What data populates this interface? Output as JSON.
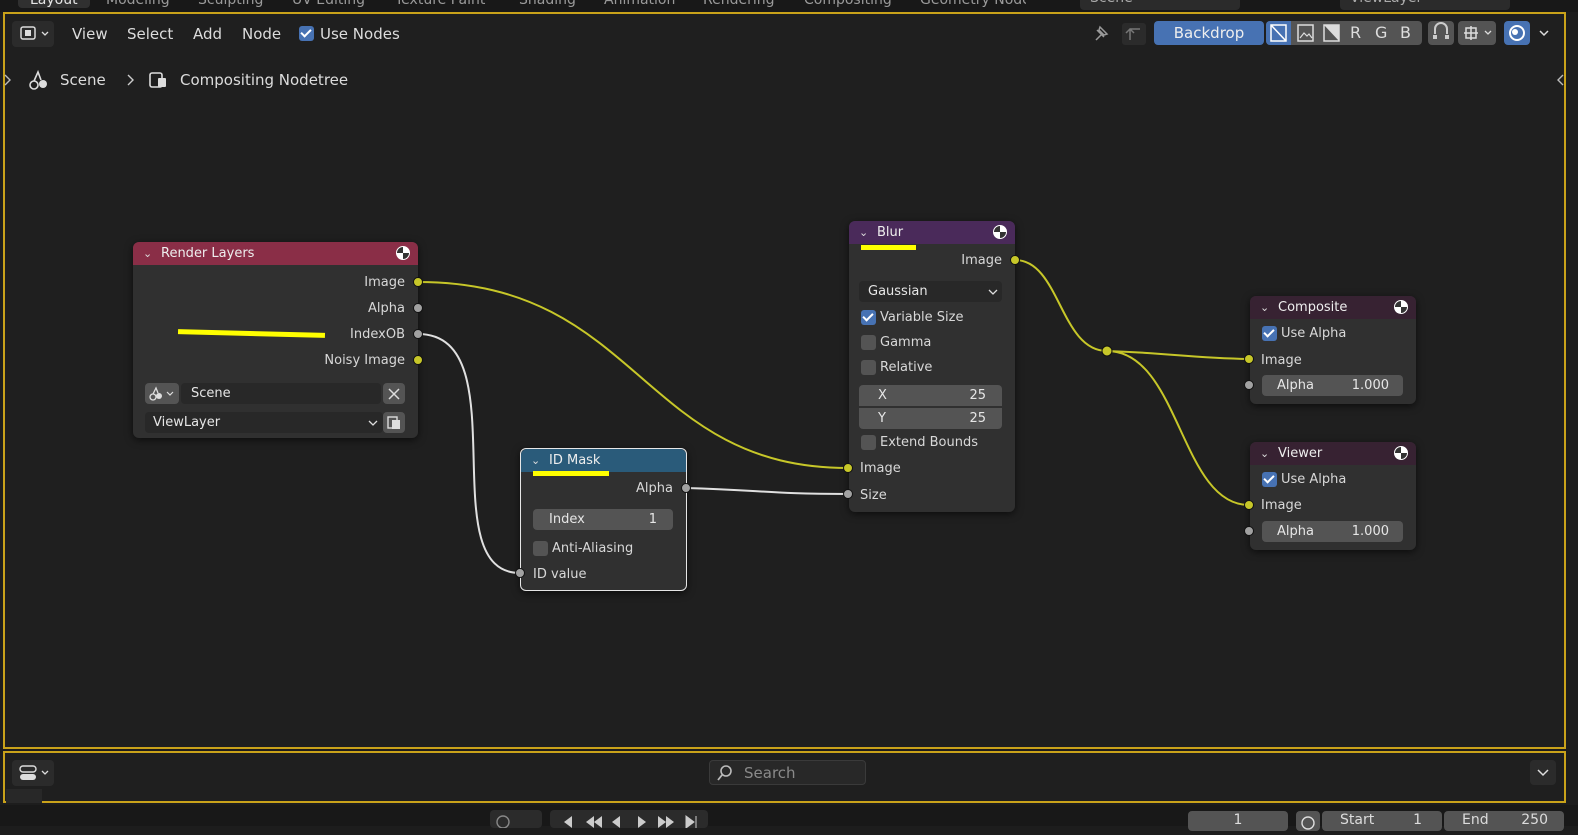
{
  "workspace_tabs": [
    "Layout",
    "Modeling",
    "Sculpting",
    "UV Editing",
    "Texture Paint",
    "Shading",
    "Animation",
    "Rendering",
    "Compositing",
    "Geometry Nodes"
  ],
  "scene_field": "Scene",
  "view_layer_field": "ViewLayer",
  "header": {
    "menus": [
      "View",
      "Select",
      "Add",
      "Node"
    ],
    "use_nodes_label": "Use Nodes",
    "backdrop_label": "Backdrop",
    "channel_buttons": [
      "R",
      "G",
      "B"
    ]
  },
  "breadcrumb": {
    "scene": "Scene",
    "nodetree": "Compositing Nodetree"
  },
  "nodes": {
    "render_layers": {
      "title": "Render Layers",
      "outputs": [
        "Image",
        "Alpha",
        "IndexOB",
        "Noisy Image"
      ],
      "scene": "Scene",
      "view_layer": "ViewLayer",
      "header_color": "#8a2e47"
    },
    "id_mask": {
      "title": "ID Mask",
      "output": "Alpha",
      "index_label": "Index",
      "index_value": "1",
      "anti_aliasing": "Anti-Aliasing",
      "input": "ID value",
      "header_color": "#2a5b7a"
    },
    "blur": {
      "title": "Blur",
      "output": "Image",
      "filter": "Gaussian",
      "variable_size": "Variable Size",
      "gamma": "Gamma",
      "relative": "Relative",
      "x_label": "X",
      "x_value": "25",
      "y_label": "Y",
      "y_value": "25",
      "extend_bounds": "Extend Bounds",
      "inputs": [
        "Image",
        "Size"
      ],
      "header_color": "#4a2a5a"
    },
    "composite": {
      "title": "Composite",
      "use_alpha": "Use Alpha",
      "image": "Image",
      "alpha_label": "Alpha",
      "alpha_value": "1.000",
      "header_color": "#372232"
    },
    "viewer": {
      "title": "Viewer",
      "use_alpha": "Use Alpha",
      "image": "Image",
      "alpha_label": "Alpha",
      "alpha_value": "1.000",
      "header_color": "#372232"
    }
  },
  "footer": {
    "search_placeholder": "Search"
  },
  "timeline": {
    "frame": "1",
    "start_label": "Start",
    "start": "1",
    "end_label": "End",
    "end": "250"
  },
  "colors": {
    "accent": "#4772b3",
    "highlight": "#ffff00",
    "link": "#c7c729",
    "border": "#c9a21a"
  }
}
